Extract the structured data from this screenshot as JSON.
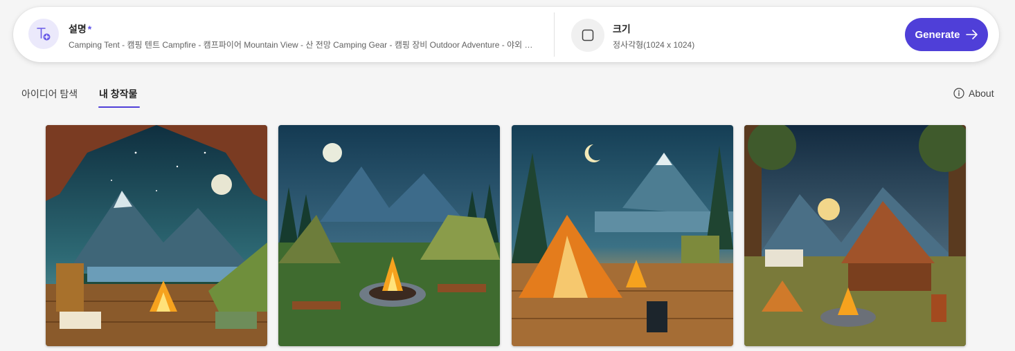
{
  "prompt": {
    "description_label": "설명",
    "required_mark": "*",
    "description_text": "Camping Tent - 캠핑 텐트 Campfire - 캠프파이어 Mountain View - 산 전망 Camping Gear - 캠핑 장비 Outdoor Adventure - 야외 모험",
    "size_label": "크기",
    "size_value": "정사각형(1024 x 1024)",
    "generate_label": "Generate"
  },
  "tabs": [
    {
      "label": "아이디어 탐색",
      "active": false
    },
    {
      "label": "내 창작물",
      "active": true
    }
  ],
  "about_label": "About",
  "colors": {
    "accent": "#4f3fd8",
    "accent_light": "#ebe9fb"
  },
  "icons": [
    "text-add-icon",
    "square-icon",
    "arrow-right-icon",
    "info-icon"
  ],
  "gallery": [
    {
      "name": "camping-image-1"
    },
    {
      "name": "camping-image-2"
    },
    {
      "name": "camping-image-3"
    },
    {
      "name": "camping-image-4"
    }
  ]
}
